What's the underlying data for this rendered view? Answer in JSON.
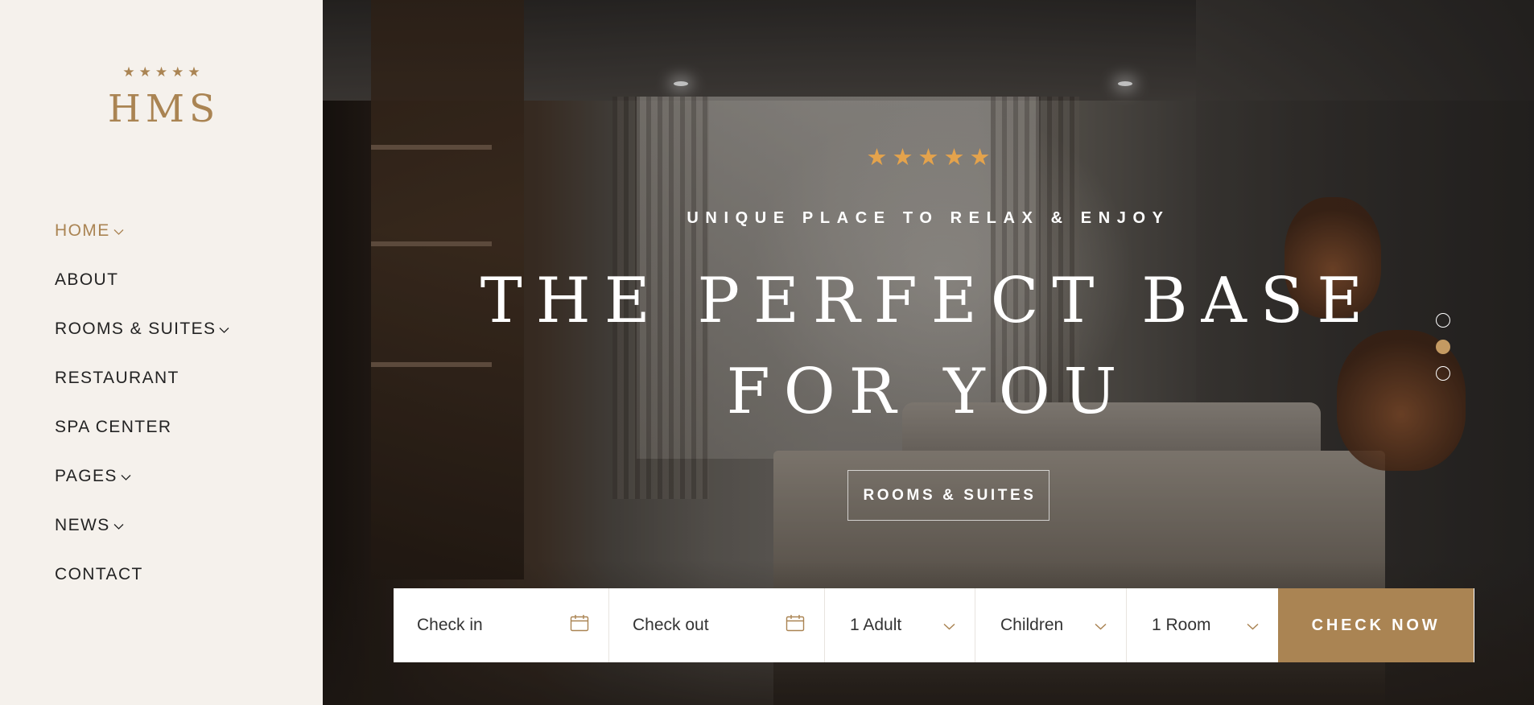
{
  "brand": {
    "stars": "★★★★★",
    "logo": "HMS",
    "accent": "#aa8453"
  },
  "nav": {
    "items": [
      {
        "label": "HOME",
        "active": true,
        "dropdown": true
      },
      {
        "label": "ABOUT",
        "dropdown": false
      },
      {
        "label": "ROOMS & SUITES",
        "dropdown": true
      },
      {
        "label": "RESTAURANT",
        "dropdown": false
      },
      {
        "label": "SPA CENTER",
        "dropdown": false
      },
      {
        "label": "PAGES",
        "dropdown": true
      },
      {
        "label": "NEWS",
        "dropdown": true
      },
      {
        "label": "CONTACT",
        "dropdown": false
      }
    ]
  },
  "hero": {
    "stars": "★★★★★",
    "subtitle": "UNIQUE PLACE TO RELAX & ENJOY",
    "title_line1": "THE PERFECT BASE",
    "title_line2": "FOR YOU",
    "button_label": "ROOMS & SUITES",
    "slider": {
      "count": 3,
      "active_index": 1
    },
    "star_color": "#e4a34c"
  },
  "booking": {
    "check_in": {
      "placeholder": "Check in",
      "icon": "calendar-icon"
    },
    "check_out": {
      "placeholder": "Check out",
      "icon": "calendar-icon"
    },
    "adults": {
      "value": "1 Adult",
      "icon": "chevron-down-icon"
    },
    "children": {
      "value": "Children",
      "icon": "chevron-down-icon"
    },
    "rooms": {
      "value": "1 Room",
      "icon": "chevron-down-icon"
    },
    "submit_label": "CHECK NOW"
  }
}
